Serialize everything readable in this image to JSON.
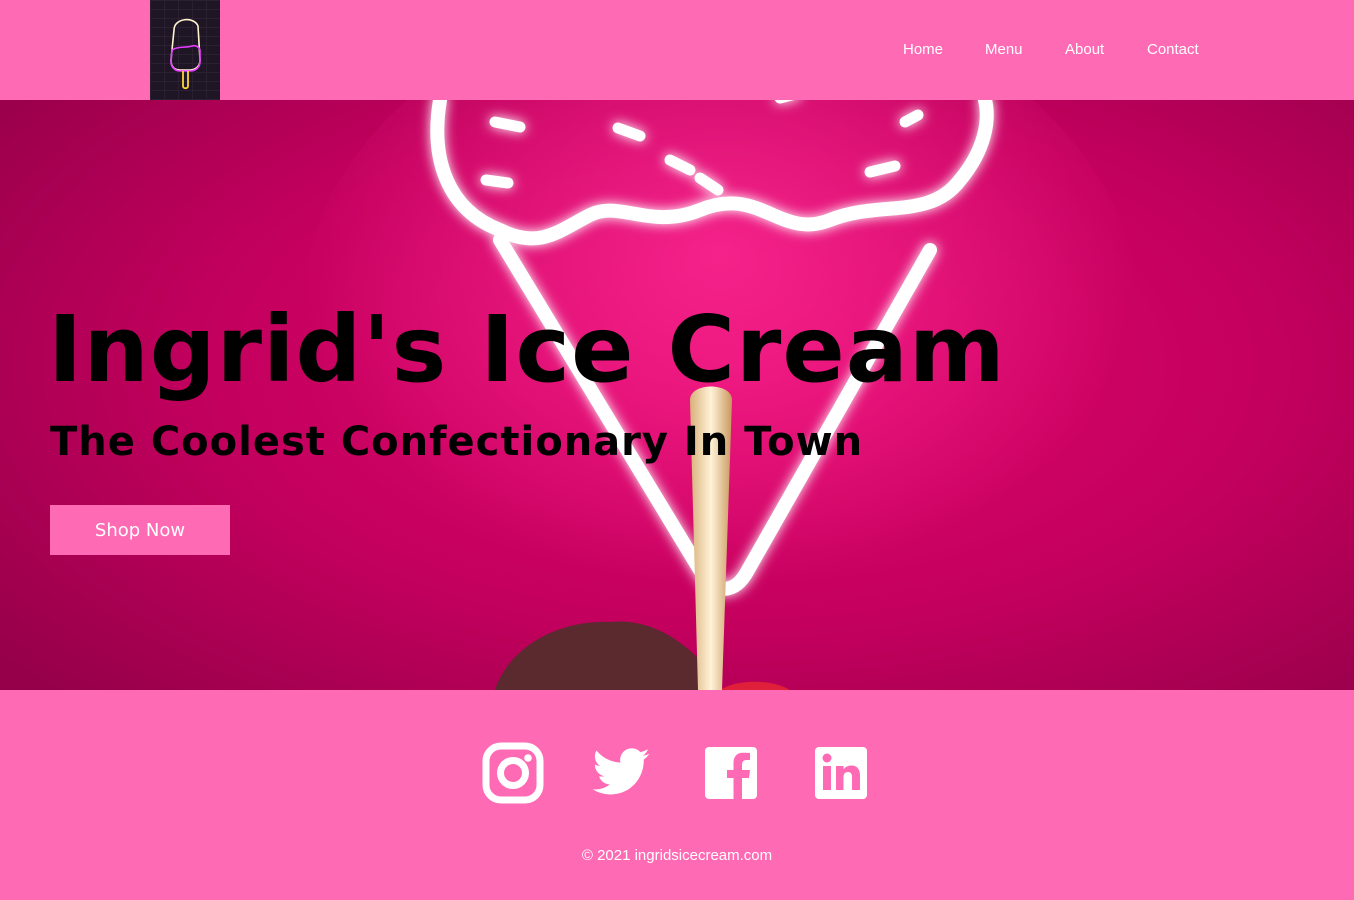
{
  "header": {
    "logo_alt": "Neon popsicle logo",
    "nav": [
      {
        "label": "Home"
      },
      {
        "label": "Menu"
      },
      {
        "label": "About"
      },
      {
        "label": "Contact"
      }
    ]
  },
  "hero": {
    "title": "Ingrid's Ice Cream",
    "subtitle": "The Coolest Confectionary In Town",
    "cta_label": "Shop Now"
  },
  "footer": {
    "socials": [
      {
        "icon": "instagram-icon"
      },
      {
        "icon": "twitter-icon"
      },
      {
        "icon": "facebook-icon"
      },
      {
        "icon": "linkedin-icon"
      }
    ],
    "copyright": "© 2021 ingridsicecream.com"
  },
  "colors": {
    "brand_pink": "#ff6ab4",
    "hero_magenta": "#c4005e",
    "text_dark": "#000000",
    "text_light": "#ffffff"
  }
}
